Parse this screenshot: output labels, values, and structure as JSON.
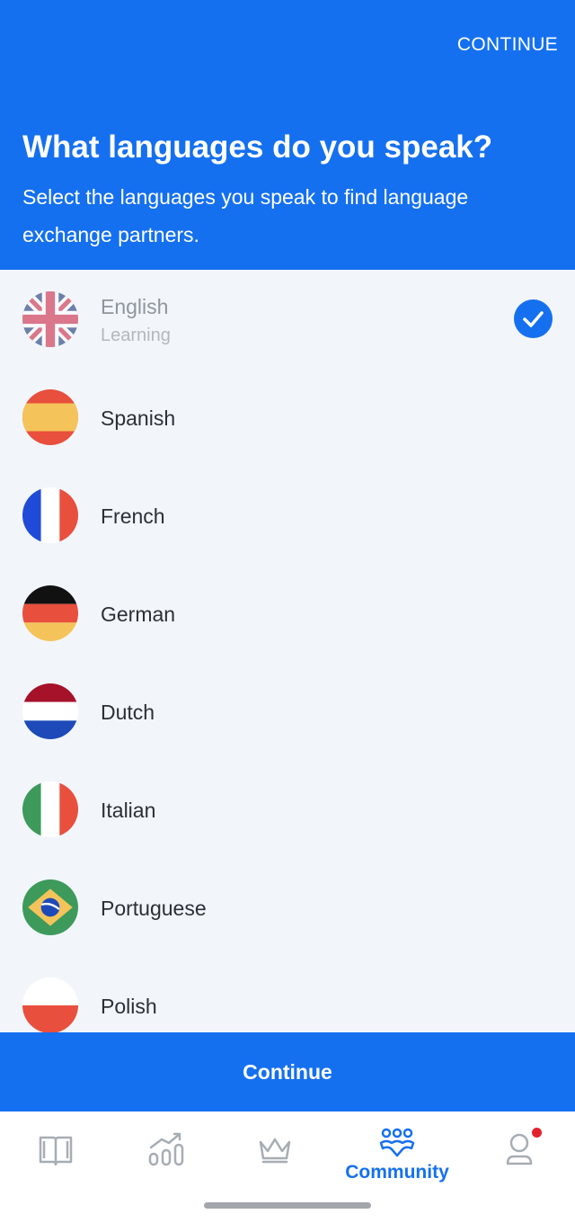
{
  "header": {
    "continue_label": "CONTINUE",
    "title": "What languages do you speak?",
    "subtitle": "Select the languages you speak to find language exchange partners."
  },
  "languages": [
    {
      "name": "English",
      "sublabel": "Learning",
      "flag": "uk-flag-icon",
      "selected": true
    },
    {
      "name": "Spanish",
      "flag": "spain-flag-icon"
    },
    {
      "name": "French",
      "flag": "france-flag-icon"
    },
    {
      "name": "German",
      "flag": "germany-flag-icon"
    },
    {
      "name": "Dutch",
      "flag": "netherlands-flag-icon"
    },
    {
      "name": "Italian",
      "flag": "italy-flag-icon"
    },
    {
      "name": "Portuguese",
      "flag": "brazil-flag-icon"
    },
    {
      "name": "Polish",
      "flag": "poland-flag-icon"
    }
  ],
  "cta": {
    "label": "Continue"
  },
  "tabbar": {
    "tabs": [
      {
        "icon": "book-icon"
      },
      {
        "icon": "progress-chart-icon"
      },
      {
        "icon": "crown-icon"
      },
      {
        "icon": "community-icon",
        "label": "Community",
        "active": true
      },
      {
        "icon": "profile-icon",
        "badge": true
      }
    ]
  },
  "colors": {
    "accent": "#1570ef",
    "background": "#f2f6fb",
    "badge": "#e5202e"
  }
}
